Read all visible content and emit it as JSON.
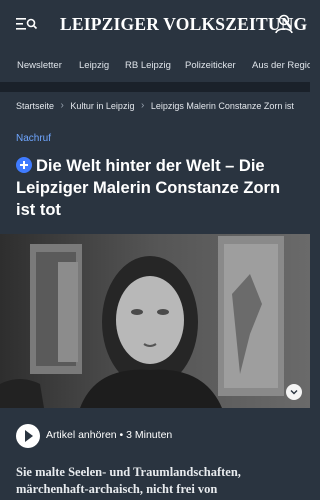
{
  "header": {
    "logo_text": "LEIPZIGER VOLKSZEITUNG",
    "menu_icon": "menu-search-icon",
    "user_icon": "user-icon"
  },
  "nav": {
    "items": [
      {
        "label": "Newsletter"
      },
      {
        "label": "Leipzig"
      },
      {
        "label": "RB Leipzig"
      },
      {
        "label": "Polizeiticker"
      },
      {
        "label": "Aus der Region"
      }
    ]
  },
  "breadcrumb": {
    "items": [
      {
        "label": "Startseite"
      },
      {
        "label": "Kultur in Leipzig"
      },
      {
        "label": "Leipzigs Malerin Constanze Zorn ist"
      }
    ]
  },
  "article": {
    "kicker": "Nachruf",
    "headline": "Die Welt hinter der Welt – Die Leipziger Malerin Constanze Zorn ist tot",
    "audio_label": "Artikel anhören • 3 Minuten",
    "teaser": "Sie malte Seelen- und Traumlandschaften, märchenhaft-archaisch, nicht frei von"
  },
  "colors": {
    "background": "#2a3440",
    "accent": "#3f7bff",
    "kicker": "#6fa6ff"
  }
}
